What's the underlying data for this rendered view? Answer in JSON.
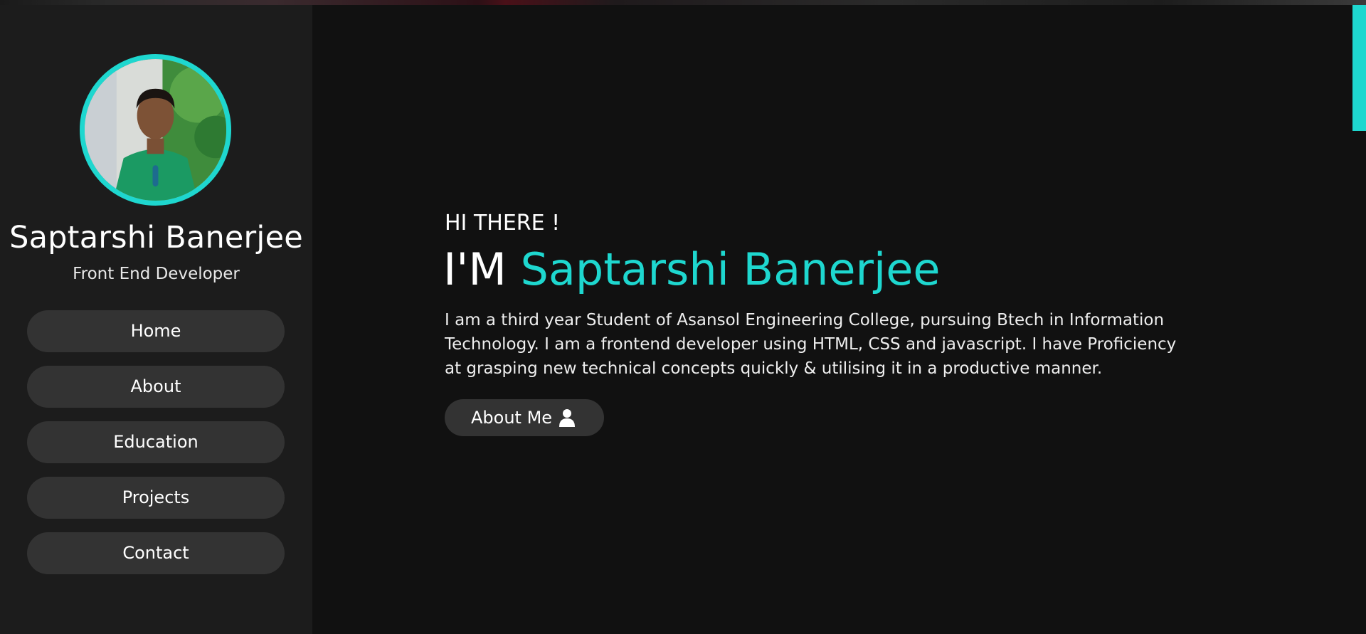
{
  "sidebar": {
    "name": "Saptarshi Banerjee",
    "role": "Front End Developer",
    "nav": [
      {
        "label": "Home"
      },
      {
        "label": "About"
      },
      {
        "label": "Education"
      },
      {
        "label": "Projects"
      },
      {
        "label": "Contact"
      }
    ]
  },
  "hero": {
    "greeting": "HI THERE !",
    "headline_prefix": "I'M ",
    "headline_name": "Saptarshi Banerjee",
    "bio": "I am a third year Student of Asansol Engineering College, pursuing Btech in Information Technology. I am a frontend developer using HTML, CSS and javascript. I have Proficiency at grasping new technical concepts quickly & utilising it in a productive manner.",
    "button_label": "About Me",
    "button_icon": "user-icon"
  },
  "theme": {
    "accent": "#1ed7cf",
    "background": "#111111",
    "sidebar_bg": "#1c1c1c",
    "button_bg": "#333333"
  }
}
